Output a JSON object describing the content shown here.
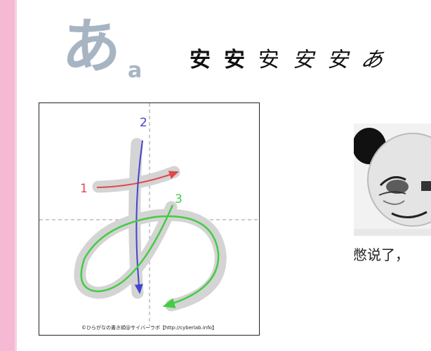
{
  "kana": "あ",
  "romaji": "a",
  "evolution": [
    "安",
    "安",
    "安",
    "安",
    "安",
    "あ"
  ],
  "strokes": {
    "labels": [
      "1",
      "2",
      "3"
    ],
    "colors": [
      "#e0484a",
      "#4444cc",
      "#44cc44"
    ]
  },
  "caption": "©ひらがなの書き順@サイバーラボ【http://cyberlab.info】",
  "meme_text": "憋说了，"
}
